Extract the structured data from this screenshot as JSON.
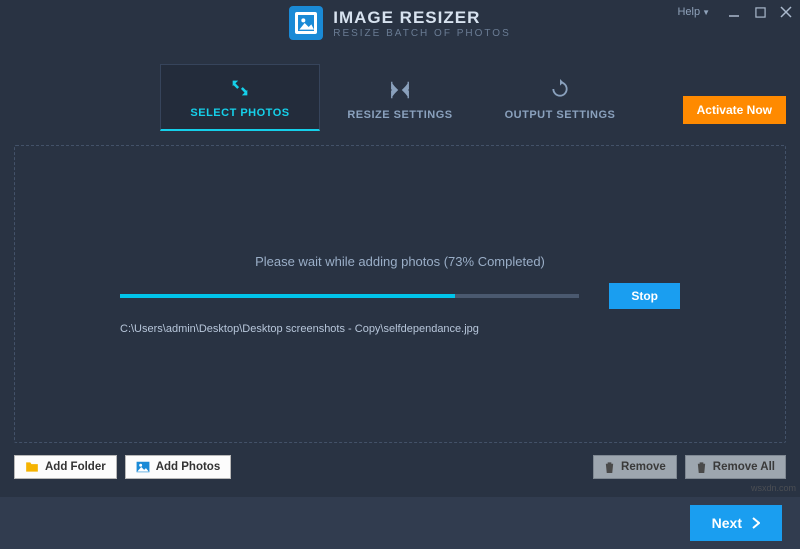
{
  "header": {
    "title": "IMAGE RESIZER",
    "subtitle": "RESIZE BATCH OF PHOTOS",
    "help_label": "Help"
  },
  "tabs": {
    "select": "SELECT PHOTOS",
    "resize": "RESIZE SETTINGS",
    "output": "OUTPUT SETTINGS"
  },
  "activate_label": "Activate Now",
  "progress": {
    "message": "Please wait while adding photos (73% Completed)",
    "percent": 73,
    "stop_label": "Stop",
    "current_file": "C:\\Users\\admin\\Desktop\\Desktop screenshots - Copy\\selfdependance.jpg"
  },
  "buttons": {
    "add_folder": "Add Folder",
    "add_photos": "Add Photos",
    "remove": "Remove",
    "remove_all": "Remove All",
    "next": "Next"
  },
  "watermark": "wsxdn.com"
}
